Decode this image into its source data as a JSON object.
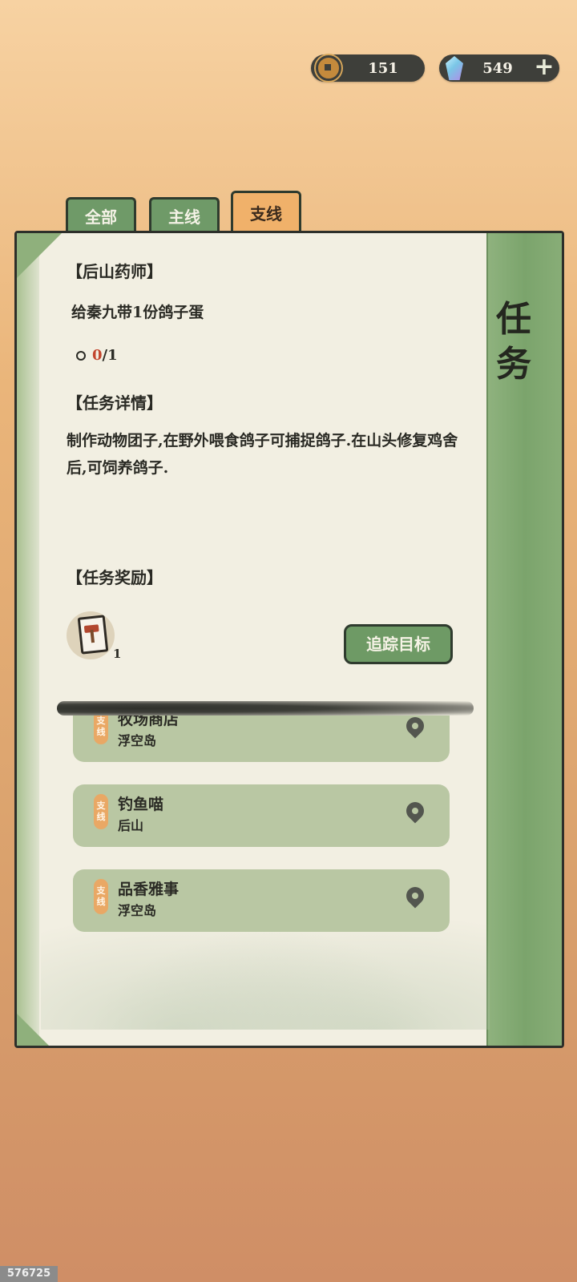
{
  "currency": {
    "coins": {
      "icon": "copper-coin-icon",
      "value": "151"
    },
    "gems": {
      "icon": "crystal-gem-icon",
      "value": "549",
      "add_label": "+"
    }
  },
  "tabs": [
    {
      "label": "全部",
      "active": false
    },
    {
      "label": "主线",
      "active": false
    },
    {
      "label": "支线",
      "active": true
    }
  ],
  "panel": {
    "side_title": [
      "任",
      "务"
    ],
    "quest": {
      "title": "【后山药师】",
      "objective": "给秦九带1份鸽子蛋",
      "progress_current": "0",
      "progress_total": "/1",
      "details_heading": "【任务详情】",
      "details_text": "制作动物团子,在野外喂食鸽子可捕捉鸽子.在山头修复鸡舍后,可饲养鸽子.",
      "rewards_heading": "【任务奖励】",
      "reward_icon": "hammer-card-icon",
      "reward_count": "1",
      "track_button": "追踪目标"
    },
    "quest_list": [
      {
        "badge": "支线",
        "name": "牧场商店",
        "location": "浮空岛"
      },
      {
        "badge": "支线",
        "name": "钓鱼喵",
        "location": "后山"
      },
      {
        "badge": "支线",
        "name": "品香雅事",
        "location": "浮空岛"
      }
    ]
  },
  "corner_id": "576725",
  "colors": {
    "tab_inactive": "#6f9a68",
    "tab_active": "#f0b16a",
    "paper": "#f2efe2",
    "band_green": "#7ba46c",
    "progress_red": "#c2452d",
    "badge_orange": "#e9a865"
  }
}
